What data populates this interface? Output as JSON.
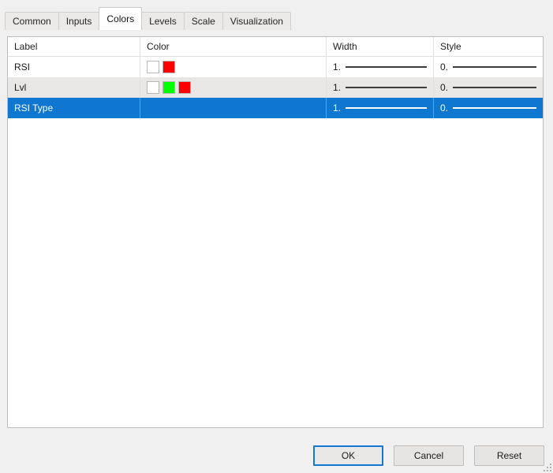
{
  "window": {
    "title": "Colors",
    "background_color": "#f0f0f0"
  },
  "tabs": [
    {
      "label": "Common",
      "active": false
    },
    {
      "label": "Inputs",
      "active": false
    },
    {
      "label": "Colors",
      "active": true
    },
    {
      "label": "Levels",
      "active": false
    },
    {
      "label": "Scale",
      "active": false
    },
    {
      "label": "Visualization",
      "active": false
    }
  ],
  "table": {
    "columns": [
      {
        "key": "label",
        "header": "Label"
      },
      {
        "key": "color",
        "header": "Color"
      },
      {
        "key": "width",
        "header": "Width"
      },
      {
        "key": "style",
        "header": "Style"
      }
    ],
    "rows": [
      {
        "label": "RSI",
        "swatches": [
          "#ffffff",
          "#ff0000"
        ],
        "width_value": "1.",
        "style_value": "0.",
        "selected": false,
        "stripe": false
      },
      {
        "label": "Lvl",
        "swatches": [
          "#ffffff",
          "#00ff00",
          "#ff0000"
        ],
        "width_value": "1.",
        "style_value": "0.",
        "selected": false,
        "stripe": true
      },
      {
        "label": "RSI Type",
        "swatches": [],
        "width_value": "1.",
        "style_value": "0.",
        "selected": true,
        "stripe": false
      }
    ]
  },
  "footer": {
    "buttons": [
      {
        "label": "OK",
        "primary": true
      },
      {
        "label": "Cancel",
        "primary": false
      },
      {
        "label": "Reset",
        "primary": false
      }
    ]
  },
  "colors": {
    "selection_blue": "#0f77d0",
    "stripe_gray": "#e9e7e5",
    "focus_blue": "#1278d4",
    "panel_white": "#ffffff",
    "border_gray": "#bdbdbd"
  }
}
